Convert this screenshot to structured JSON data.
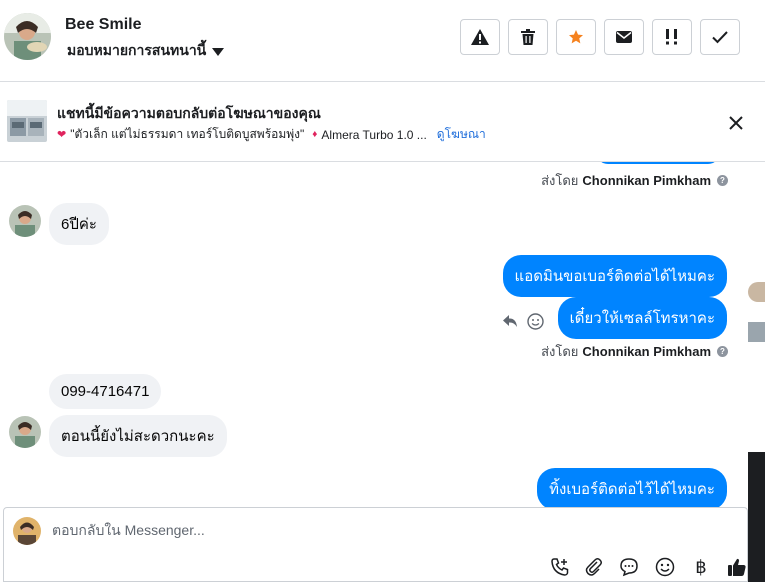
{
  "header": {
    "title": "Bee Smile",
    "assign_label": "มอบหมายการสนทนานี้"
  },
  "ad_banner": {
    "title": "แชทนี้มีข้อความตอบกลับต่อโฆษณาของคุณ",
    "description": "\"ตัวเล็ก แต่ไม่ธรรมดา เทอร์โบติดบูสพร้อมพุ่ง\"",
    "description_tail": "Almera Turbo 1.0 ...",
    "link_label": "ดูโฆษณา"
  },
  "messages": {
    "sent_prefix": "ส่งโดย",
    "agent_name": "Chonnikan Pimkham",
    "m1": "6ปีค่ะ",
    "m2": "แอดมินขอเบอร์ติดต่อได้ไหมคะ",
    "m3": "เดี๋ยวให้เซลล์โทรหาคะ",
    "m4": "099-4716471",
    "m5": "ตอนนี้ยังไม่สะดวกนะคะ",
    "m6": "ทิ้งเบอร์ติดต่อไว้ได้ไหมคะ"
  },
  "composer": {
    "placeholder": "ตอบกลับใน Messenger...",
    "currency_symbol": "฿"
  },
  "colors": {
    "accent": "#0084ff",
    "incoming_bubble": "#f0f2f5",
    "star": "#f5821f",
    "link": "#216fdb"
  },
  "icons": [
    "alert-icon",
    "trash-icon",
    "star-icon",
    "envelope-icon",
    "exclamation-icon",
    "check-icon",
    "close-icon",
    "reply-icon",
    "emoji-icon",
    "add-call-icon",
    "attachment-icon",
    "speech-bubble-icon",
    "baht-icon",
    "thumbs-up-icon"
  ]
}
